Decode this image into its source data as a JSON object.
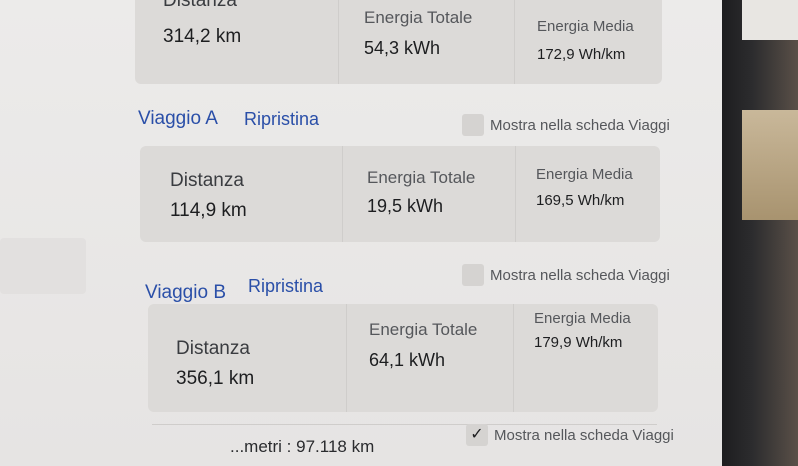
{
  "top_card": {
    "distance_label": "Distanza",
    "distance_value": "314,2 km",
    "energy_label": "Energia Totale",
    "energy_value": "54,3 kWh",
    "avg_label": "Energia Media",
    "avg_value": "172,9 Wh/km"
  },
  "trip_a": {
    "title": "Viaggio A",
    "reset_label": "Ripristina",
    "show_label": "Mostra nella scheda Viaggi",
    "show_checked": false,
    "distance_label": "Distanza",
    "distance_value": "114,9 km",
    "energy_label": "Energia Totale",
    "energy_value": "19,5 kWh",
    "avg_label": "Energia Media",
    "avg_value": "169,5 Wh/km"
  },
  "trip_b": {
    "title": "Viaggio B",
    "reset_label": "Ripristina",
    "show_label": "Mostra nella scheda Viaggi",
    "show_checked": false,
    "distance_label": "Distanza",
    "distance_value": "356,1 km",
    "energy_label": "Energia Totale",
    "energy_value": "64,1 kWh",
    "avg_label": "Energia Media",
    "avg_value": "179,9 Wh/km"
  },
  "odometer": {
    "text": "...metri : 97.118 km",
    "show_label": "Mostra nella scheda Viaggi",
    "show_checked": true
  },
  "colors": {
    "accent_link": "#2a4fa8",
    "screen_bg": "#ecebea",
    "card_bg": "#dcdad8"
  }
}
